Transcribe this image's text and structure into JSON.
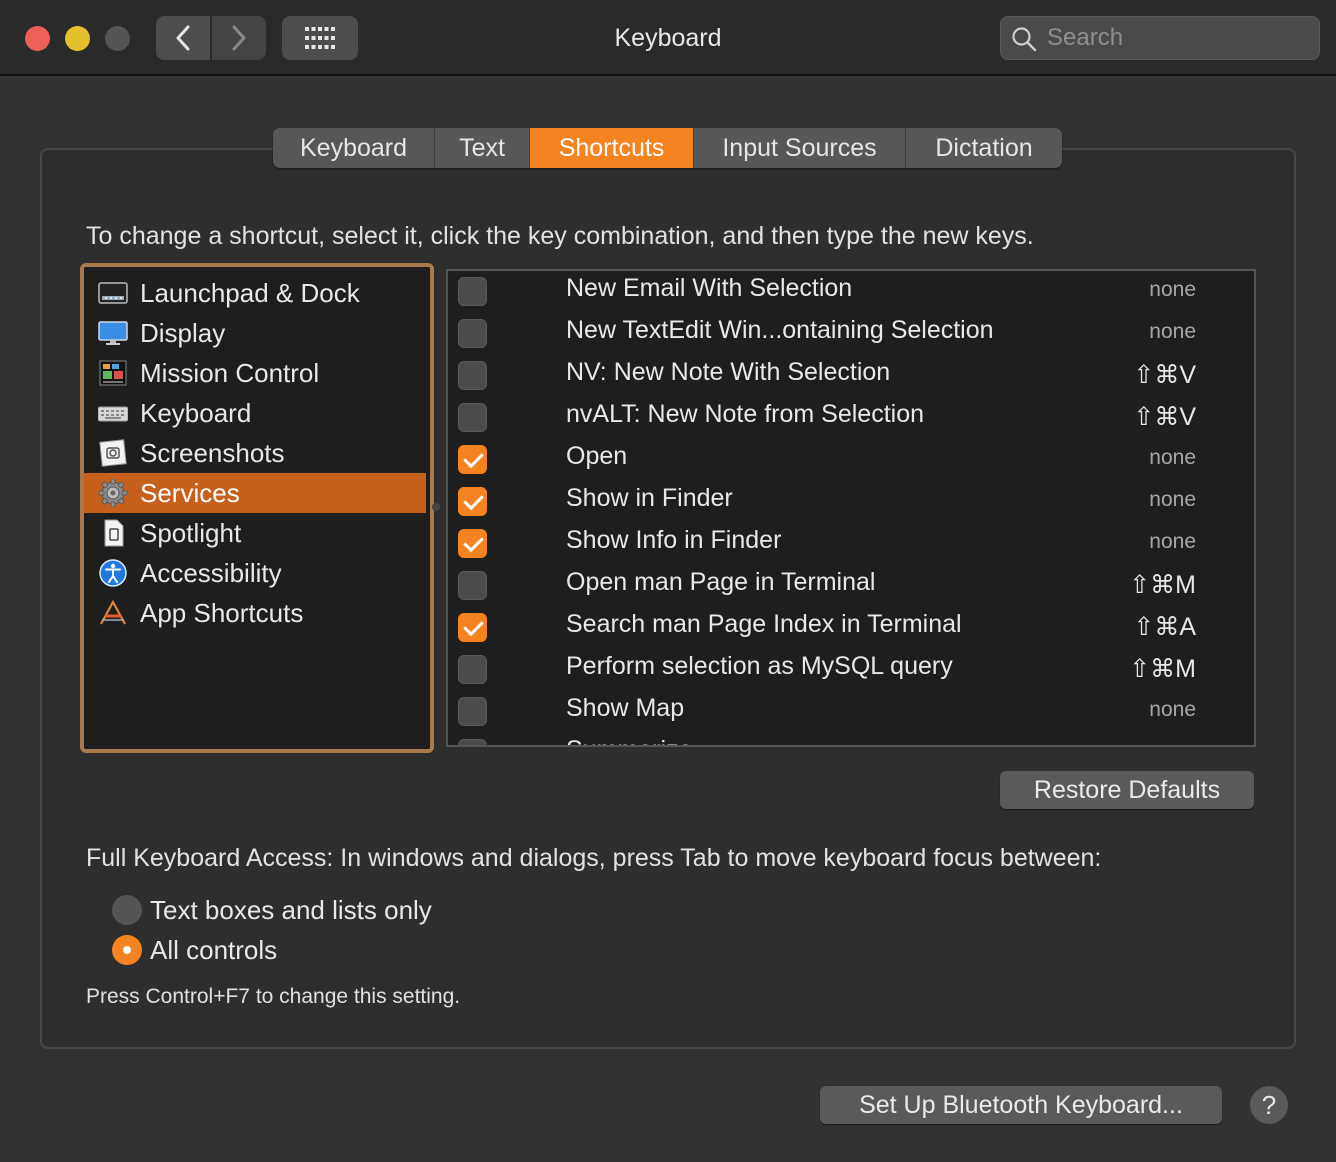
{
  "window": {
    "title": "Keyboard"
  },
  "search": {
    "placeholder": "Search",
    "icon": "search-icon"
  },
  "tabs": [
    {
      "label": "Keyboard"
    },
    {
      "label": "Text"
    },
    {
      "label": "Shortcuts",
      "active": true
    },
    {
      "label": "Input Sources"
    },
    {
      "label": "Dictation"
    }
  ],
  "instruction": "To change a shortcut, select it, click the key combination, and then type the new keys.",
  "categories": [
    {
      "label": "Launchpad & Dock",
      "icon": "launchpad-dock-icon"
    },
    {
      "label": "Display",
      "icon": "display-icon"
    },
    {
      "label": "Mission Control",
      "icon": "mission-control-icon"
    },
    {
      "label": "Keyboard",
      "icon": "keyboard-icon"
    },
    {
      "label": "Screenshots",
      "icon": "screenshots-icon"
    },
    {
      "label": "Services",
      "icon": "services-gear-icon",
      "selected": true
    },
    {
      "label": "Spotlight",
      "icon": "spotlight-icon"
    },
    {
      "label": "Accessibility",
      "icon": "accessibility-icon"
    },
    {
      "label": "App Shortcuts",
      "icon": "app-shortcuts-icon"
    }
  ],
  "shortcuts": [
    {
      "label": "New Email With Selection",
      "key": "none",
      "checked": false
    },
    {
      "label": "New TextEdit Win...ontaining Selection",
      "key": "none",
      "checked": false
    },
    {
      "label": "NV: New Note With Selection",
      "key": "⇧⌘V",
      "checked": false
    },
    {
      "label": "nvALT: New Note from Selection",
      "key": "⇧⌘V",
      "checked": false
    },
    {
      "label": "Open",
      "key": "none",
      "checked": true
    },
    {
      "label": "Show in Finder",
      "key": "none",
      "checked": true
    },
    {
      "label": "Show Info in Finder",
      "key": "none",
      "checked": true
    },
    {
      "label": "Open man Page in Terminal",
      "key": "⇧⌘M",
      "checked": false
    },
    {
      "label": "Search man Page Index in Terminal",
      "key": "⇧⌘A",
      "checked": true
    },
    {
      "label": "Perform selection as MySQL query",
      "key": "⇧⌘M",
      "checked": false
    },
    {
      "label": "Show Map",
      "key": "none",
      "checked": false
    },
    {
      "label": "Summarize",
      "key": "",
      "checked": false
    }
  ],
  "restore_defaults": "Restore Defaults",
  "full_keyboard_access": {
    "text": "Full Keyboard Access: In windows and dialogs, press Tab to move keyboard focus between:",
    "options": [
      {
        "label": "Text boxes and lists only",
        "selected": false
      },
      {
        "label": "All controls",
        "selected": true
      }
    ],
    "note": "Press Control+F7 to change this setting."
  },
  "bluetooth_button": "Set Up Bluetooth Keyboard...",
  "help_button": "?",
  "colors": {
    "accent": "#f5831f",
    "selected_row": "#c8601d"
  }
}
